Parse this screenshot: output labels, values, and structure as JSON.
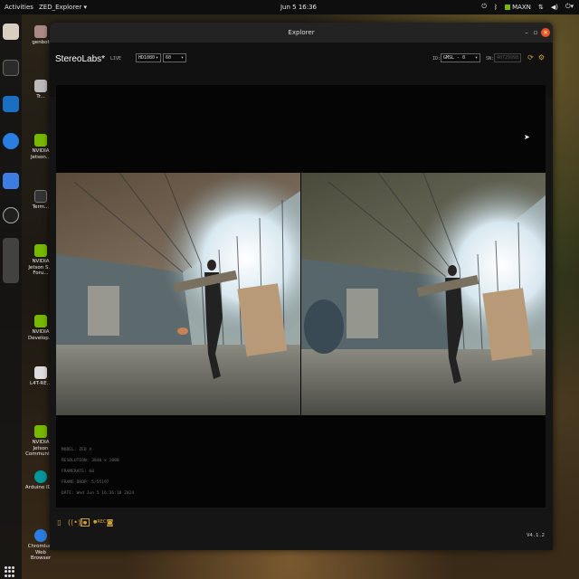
{
  "topbar": {
    "activities": "Activities",
    "app_menu": "ZED_Explorer",
    "clock": "Jun 5 16:36",
    "power_mode": "MAXN"
  },
  "desktop": {
    "icons": [
      {
        "label": "genbot"
      },
      {
        "label": "Tr..."
      },
      {
        "label": "NVIDIA Jetson..."
      },
      {
        "label": "Term..."
      },
      {
        "label": "NVIDIA Jetson S... Foru..."
      },
      {
        "label": "NVIDIA Develop..."
      },
      {
        "label": "L4T-RE..."
      },
      {
        "label": "NVIDIA Jetson Communit..."
      },
      {
        "label": "Arduino ID..."
      },
      {
        "label": "Chromium Web Browser"
      }
    ]
  },
  "window": {
    "title": "Explorer",
    "brand": "StereoLabs*",
    "mode": "LIVE",
    "resolution_select": "HD1080",
    "fps_select": "60",
    "id_label": "ID:",
    "id_select": "GMSL - 0",
    "sn_label": "SN:",
    "sn_value": "40729998"
  },
  "info": {
    "model": "MODEL: ZED X",
    "resolution": "RESOLUTION: 3840 x 1080",
    "framerate": "FRAMERATE: 60",
    "frame_drop": "FRAME DROP: 5/55197",
    "date": "DATE: Wed Jun 5 16:36:10 2024"
  },
  "footer": {
    "version": "V4.1.2"
  },
  "colors": {
    "accent": "#cfa040",
    "ubuntu_orange": "#e95420",
    "nvidia_green": "#76b900"
  }
}
